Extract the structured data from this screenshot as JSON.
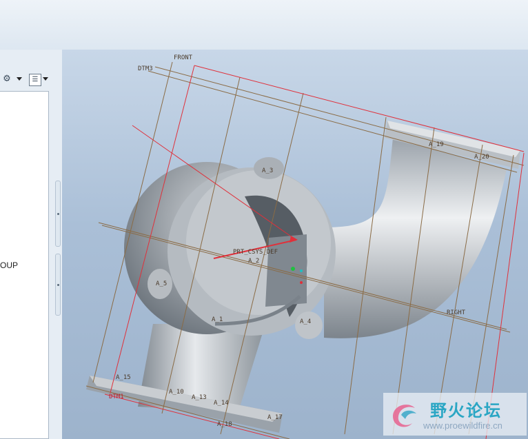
{
  "tree_panel": {
    "partial_text": "OUP"
  },
  "toolbar": {
    "filter_icon": "tools-icon",
    "tree_settings_icon": "tree-settings-icon"
  },
  "viewport": {
    "datum_labels": {
      "front": "FRONT",
      "dtm3": "DTM3",
      "right": "RIGHT",
      "dtm_bottom": "DTM1",
      "csys": "PRT_CSYS_DEF"
    },
    "axis_labels": [
      "A_3",
      "A_19",
      "A_20",
      "A_2",
      "A_5",
      "A_1",
      "A_4",
      "A_15",
      "A_10",
      "A_13",
      "A_14",
      "A_17",
      "A_18"
    ],
    "colors": {
      "datum_plane": "#8a6b45",
      "datum_boundary": "#e0303a",
      "part_shade": "#c2c7cc"
    }
  },
  "watermark": {
    "cn_text": "野火论坛",
    "url": "www.proewildfire.cn"
  }
}
